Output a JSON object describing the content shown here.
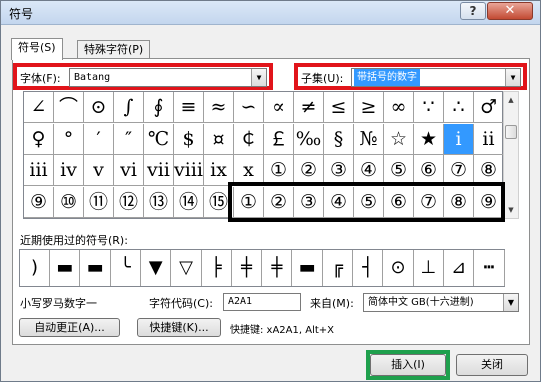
{
  "window": {
    "title": "符号",
    "help_label": "?",
    "close_label": "✕"
  },
  "tabs": [
    {
      "label": "符号(S)"
    },
    {
      "label": "特殊字符(P)"
    }
  ],
  "font": {
    "label": "字体(F):",
    "value": "Batang"
  },
  "subset": {
    "label": "子集(U):",
    "value": "带括号的数字"
  },
  "symbols": [
    "∠",
    "⌒",
    "⊙",
    "∫",
    "∮",
    "≡",
    "≈",
    "∽",
    "∝",
    "≠",
    "≤",
    "≥",
    "∞",
    "∵",
    "∴",
    "♂",
    "♀",
    "°",
    "′",
    "″",
    "℃",
    "$",
    "¤",
    "￠",
    "￡",
    "‰",
    "§",
    "№",
    "☆",
    "★",
    "ⅰ",
    "ⅱ",
    "ⅲ",
    "ⅳ",
    "ⅴ",
    "ⅵ",
    "ⅶ",
    "ⅷ",
    "ⅸ",
    "ⅹ",
    "①",
    "②",
    "③",
    "④",
    "⑤",
    "⑥",
    "⑦",
    "⑧",
    "⑨",
    "⑩",
    "⑪",
    "⑫",
    "⑬",
    "⑭",
    "⑮",
    "①",
    "②",
    "③",
    "④",
    "⑤",
    "⑥",
    "⑦",
    "⑧",
    "⑨"
  ],
  "selected_symbol_index": 30,
  "recent": {
    "label": "近期使用过的符号(R):",
    "items": [
      ")",
      "▬",
      "▬",
      "╰",
      "▼",
      "▽",
      "╞",
      "╪",
      "╪",
      "▬",
      "╔",
      "┤",
      "⊙",
      "⊥",
      "⊿",
      "┅"
    ]
  },
  "char_name": "小写罗马数字一",
  "char_code": {
    "label": "字符代码(C):",
    "value": "A2A1"
  },
  "from": {
    "label": "来自(M):",
    "value": "简体中文 GB(十六进制)"
  },
  "buttons": {
    "autocorrect": "自动更正(A)...",
    "shortcut": "快捷键(K)...",
    "insert": "插入(I)",
    "close": "关闭"
  },
  "shortcut_text": "快捷键: xA2A1, Alt+X"
}
